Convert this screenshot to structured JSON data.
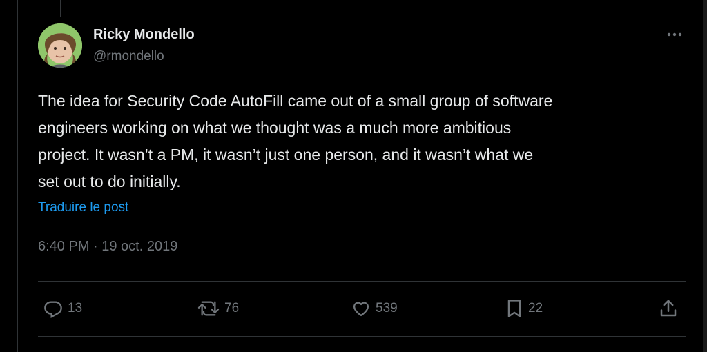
{
  "author": {
    "name": "Ricky Mondello",
    "handle": "@rmondello",
    "avatar": "avatar"
  },
  "post": {
    "text": "The idea for Security Code AutoFill came out of a small group of software\nengineers working on what we thought was a much more ambitious\nproject. It wasn’t a PM, it wasn’t just one person, and it wasn’t what we\nset out to do initially.",
    "translate_label": "Traduire le post",
    "timestamp": "6:40 PM · 19 oct. 2019"
  },
  "actions": {
    "replies": "13",
    "reposts": "76",
    "likes": "539",
    "bookmarks": "22"
  },
  "icons": {
    "more": "more-horizontal-icon",
    "reply": "reply-icon",
    "repost": "repost-icon",
    "like": "heart-icon",
    "bookmark": "bookmark-icon",
    "share": "share-icon"
  },
  "colors": {
    "background": "#000000",
    "text": "#e7e9ea",
    "muted": "#71767b",
    "link": "#1d9bf0",
    "border": "#2f3336"
  }
}
